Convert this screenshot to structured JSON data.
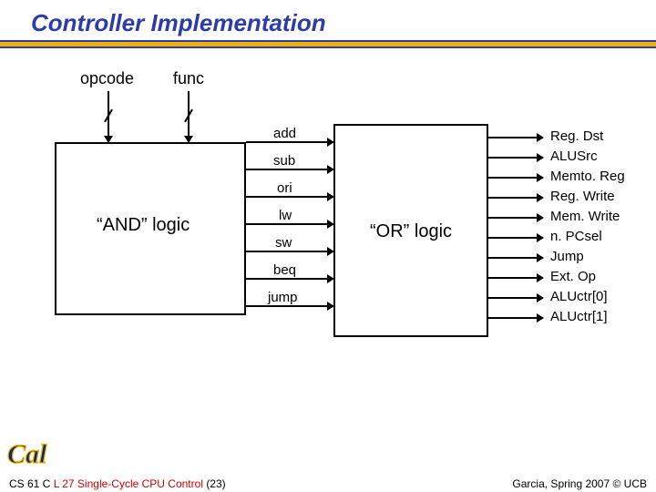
{
  "title": "Controller Implementation",
  "inputs": {
    "opcode": "opcode",
    "func": "func"
  },
  "and_block": "“AND” logic",
  "or_block": "“OR” logic",
  "intermediate": [
    "add",
    "sub",
    "ori",
    "lw",
    "sw",
    "beq",
    "jump"
  ],
  "outputs": [
    "Reg. Dst",
    "ALUSrc",
    "Memto. Reg",
    "Reg. Write",
    "Mem. Write",
    "n. PCsel",
    "Jump",
    "Ext. Op",
    "ALUctr[0]",
    "ALUctr[1]"
  ],
  "footer": {
    "course": "CS 61 C ",
    "lecture": "L 27 Single-Cycle CPU Control ",
    "page": "(23)",
    "right": "Garcia, Spring 2007 © UCB"
  },
  "logo_alt": "Cal"
}
